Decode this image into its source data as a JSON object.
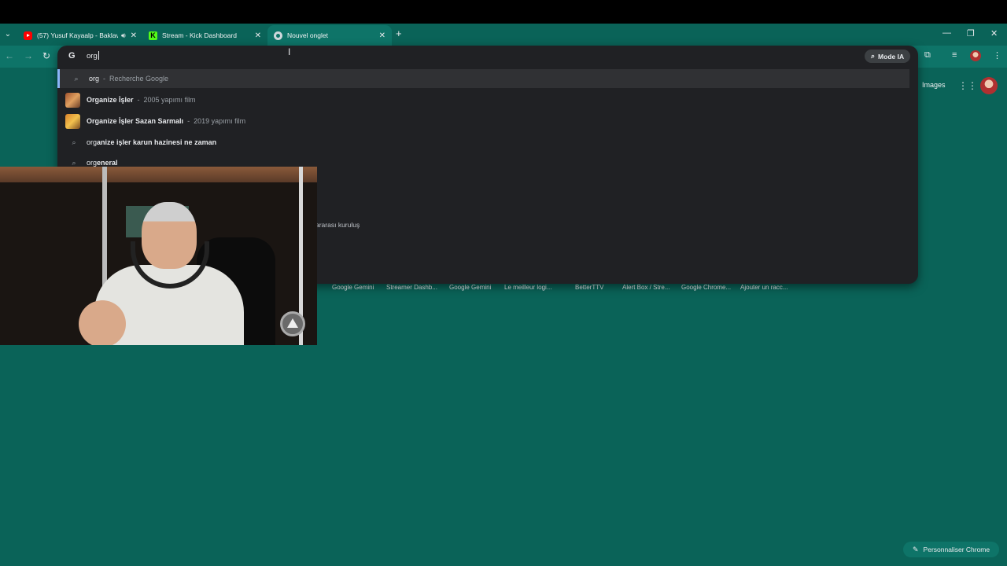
{
  "tabs": [
    {
      "title": "(57) Yusuf Kayaalp - Baklav",
      "favicon": "youtube-icon",
      "audio": true
    },
    {
      "title": "Stream - Kick Dashboard",
      "favicon": "kick-icon",
      "audio": false
    },
    {
      "title": "Nouvel onglet",
      "favicon": "chrome-icon",
      "audio": false,
      "active": true
    }
  ],
  "omnibox": {
    "value": "org",
    "mode_ia_label": "Mode IA"
  },
  "suggestions": [
    {
      "typed": "org",
      "rest": "",
      "sep": "-",
      "sub": "Recherche Google",
      "type": "search"
    },
    {
      "main": "Organize İşler",
      "sep": "-",
      "sub": "2005 yapımı film",
      "type": "entity"
    },
    {
      "main": "Organize İşler Sazan Sarmalı",
      "sep": "-",
      "sub": "2019 yapımı film",
      "type": "entity"
    },
    {
      "typed": "org",
      "rest": "anize işler karun hazinesi ne zaman",
      "type": "search"
    },
    {
      "typed": "org",
      "rest": "eneral",
      "type": "search"
    }
  ],
  "hidden_partial_text": "ararası kuruluş",
  "header_links": {
    "images": "Images"
  },
  "shortcuts": [
    "Google Gemini",
    "Streamer Dashb...",
    "Google Gemini",
    "Le meilleur logi...",
    "BetterTTV",
    "Alert Box / Stre...",
    "Google Chrome...",
    "Ajouter un racc..."
  ],
  "customize_label": "Personnaliser Chrome",
  "colors": {
    "page_background": "#0a6358",
    "omnibox_background": "#202124",
    "accent": "#8ab4f8"
  }
}
